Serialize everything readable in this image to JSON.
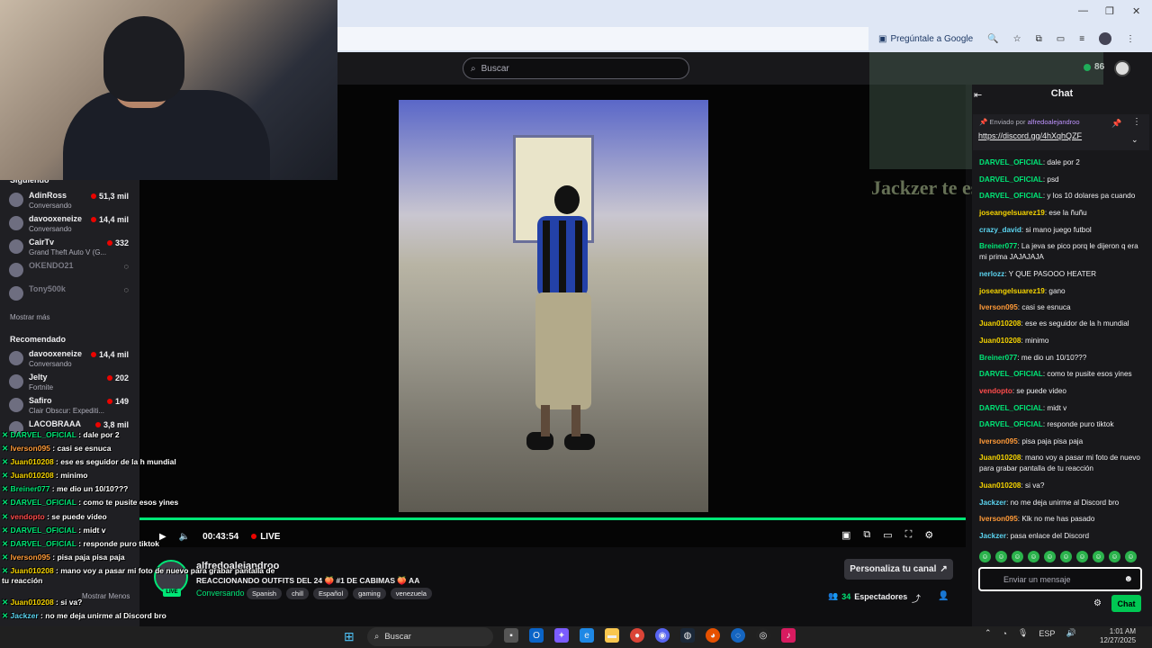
{
  "browser": {
    "ask_google": "Pregúntale a Google",
    "window_controls": [
      "—",
      "❐",
      "✕"
    ]
  },
  "twitch": {
    "search_placeholder": "Buscar",
    "bits_count": "86"
  },
  "sidebar": {
    "following_title": "Siguiendo",
    "following": [
      {
        "name": "AdinRoss",
        "game": "Conversando",
        "viewers": "51,3 mil"
      },
      {
        "name": "davooxeneize",
        "game": "Conversando",
        "viewers": "14,4 mil"
      },
      {
        "name": "CairTv",
        "game": "Grand Theft Auto V (G...",
        "viewers": "332"
      },
      {
        "name": "OKENDO21",
        "game": "",
        "viewers": ""
      },
      {
        "name": "Tony500k",
        "game": "",
        "viewers": ""
      }
    ],
    "show_more": "Mostrar más",
    "recommended_title": "Recomendado",
    "recommended": [
      {
        "name": "davooxeneize",
        "game": "Conversando",
        "viewers": "14,4 mil"
      },
      {
        "name": "Jelty",
        "game": "Fortnite",
        "viewers": "202"
      },
      {
        "name": "Safiro",
        "game": "Clair Obscur: Expediti...",
        "viewers": "149"
      },
      {
        "name": "LACOBRAAA",
        "game": "",
        "viewers": "3,8 mil"
      }
    ],
    "show_less": "Mostrar Menos"
  },
  "overlay_chat": [
    {
      "user": "DARVEL_OFICIAL",
      "text": "dale por 2"
    },
    {
      "user": "Iverson095",
      "text": "casi se esnuca"
    },
    {
      "user": "Juan010208",
      "text": "ese es seguidor de la h mundial"
    },
    {
      "user": "Juan010208",
      "text": "minimo"
    },
    {
      "user": "Breiner077",
      "text": "me dio un 10/10???"
    },
    {
      "user": "DARVEL_OFICIAL",
      "text": "como te pusite esos yines"
    },
    {
      "user": "vendopto",
      "text": "se puede video"
    },
    {
      "user": "DARVEL_OFICIAL",
      "text": "midt v"
    },
    {
      "user": "DARVEL_OFICIAL",
      "text": "responde puro tiktok"
    },
    {
      "user": "Iverson095",
      "text": "pisa paja pisa paja"
    },
    {
      "user": "Juan010208",
      "text": "mano voy a pasar mi foto de nuevo para grabar pantalla de tu reacción"
    },
    {
      "user": "Juan010208",
      "text": "si va?"
    },
    {
      "user": "Jackzer",
      "text": "no me deja unirme al Discord bro"
    },
    {
      "user": "Iverson095",
      "text": "Klk no me has pasado"
    },
    {
      "user": "Jackzer",
      "text": "pasa enlace del Discord"
    }
  ],
  "video_overlay_text": "Jackzer te esta jalando bola",
  "player": {
    "time": "00:43:54",
    "live": "LIVE",
    "progress": 1.0
  },
  "stream": {
    "name": "alfredoalejandroo",
    "title": "REACCIONANDO OUTFITS DEL 24 🍑 #1 DE CABIMAS 🍑 AA",
    "category": "Conversando",
    "tags": [
      "Spanish",
      "chill",
      "Español",
      "gaming",
      "venezuela"
    ],
    "live_badge": "LIVE",
    "personalize": "Personaliza tu canal",
    "viewers": "34",
    "viewers_label": "Espectadores"
  },
  "chat": {
    "title": "Chat",
    "pinned_by": "Enviado por",
    "pinned_user": "alfredoalejandroo",
    "pinned_link": "https://discord.gg/4hXqhQZF",
    "messages": [
      {
        "user": "DARVEL_OFICIAL",
        "text": "dale por 2",
        "color": "c-g"
      },
      {
        "user": "DARVEL_OFICIAL",
        "text": "psd",
        "color": "c-g"
      },
      {
        "user": "DARVEL_OFICIAL",
        "text": "y los 10 dolares pa cuando",
        "color": "c-g"
      },
      {
        "user": "joseangelsuarez19",
        "text": "ese la ñuñu",
        "color": "c-y"
      },
      {
        "user": "crazy_david",
        "text": "si mano juego futbol",
        "color": "c-c"
      },
      {
        "user": "Breiner077",
        "text": "La jeva se pico porq le dijeron q era mi prima JAJAJAJA",
        "color": "c-g"
      },
      {
        "user": "nerlozz",
        "text": "Y QUE PASOOO HEATER",
        "color": "c-c"
      },
      {
        "user": "joseangelsuarez19",
        "text": "gano",
        "color": "c-y"
      },
      {
        "user": "Iverson095",
        "text": "casi se esnuca",
        "color": "c-o"
      },
      {
        "user": "Juan010208",
        "text": "ese es seguidor de la h mundial",
        "color": "c-y"
      },
      {
        "user": "Juan010208",
        "text": "minimo",
        "color": "c-y"
      },
      {
        "user": "Breiner077",
        "text": "me dio un 10/10???",
        "color": "c-g"
      },
      {
        "user": "DARVEL_OFICIAL",
        "text": "como te pusite esos yines",
        "color": "c-g"
      },
      {
        "user": "vendopto",
        "text": "se puede video",
        "color": "c-r"
      },
      {
        "user": "DARVEL_OFICIAL",
        "text": "midt v",
        "color": "c-g"
      },
      {
        "user": "DARVEL_OFICIAL",
        "text": "responde puro tiktok",
        "color": "c-g"
      },
      {
        "user": "Iverson095",
        "text": "pisa paja pisa paja",
        "color": "c-o"
      },
      {
        "user": "Juan010208",
        "text": "mano voy a pasar mi foto de nuevo para grabar pantalla de tu reacción",
        "color": "c-y"
      },
      {
        "user": "Juan010208",
        "text": "si va?",
        "color": "c-y"
      },
      {
        "user": "Jackzer",
        "text": "no me deja unirme al Discord bro",
        "color": "c-c"
      },
      {
        "user": "Iverson095",
        "text": "Klk no me has pasado",
        "color": "c-o"
      },
      {
        "user": "Jackzer",
        "text": "pasa enlace del Discord",
        "color": "c-c"
      }
    ],
    "input_placeholder": "Enviar un mensaje",
    "send_label": "Chat"
  },
  "taskbar": {
    "search": "Buscar",
    "lang": "ESP",
    "time": "1:01 AM",
    "date": "12/27/2025"
  }
}
